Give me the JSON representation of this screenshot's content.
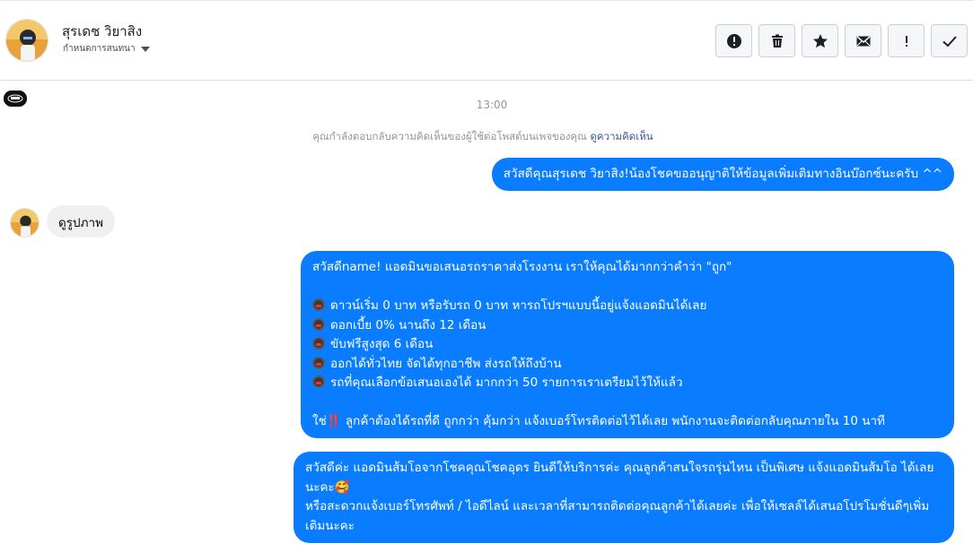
{
  "header": {
    "contact_name": "สุรเดช วิยาสิง",
    "subtitle": "กำหนดการสนทนา",
    "actions": [
      {
        "icon": "alert-circle-icon",
        "name": "report-button"
      },
      {
        "icon": "trash-icon",
        "name": "delete-button"
      },
      {
        "icon": "star-icon",
        "name": "star-button"
      },
      {
        "icon": "mail-icon",
        "name": "mark-unread-button"
      },
      {
        "icon": "exclamation-icon",
        "name": "follow-up-button"
      },
      {
        "icon": "check-icon",
        "name": "done-button"
      }
    ]
  },
  "thread": {
    "time": "13:00",
    "notice_text": "คุณกำลังตอบกลับความคิดเห็นของผู้ใช้ต่อโพสต์บนเพจของคุณ ",
    "notice_link": "ดูความคิดเห็น",
    "messages": {
      "m1": "สวัสดีคุณสุรเดช วิยาสิง!น้องโชคขออนุญาติให้ข้อมูลเพิ่มเติมทางอินบ๊อกซ์นะครับ ^^",
      "m2": "ดูรูปภาพ",
      "m3": {
        "l1": "สวัสดีname! แอดมินขอเสนอรถราคาส่งโรงงาน เราให้คุณได้มากกว่าคำว่า \"ถูก\"",
        "l2": "ดาวน์เริ่ม 0 บาท หรือรับรถ 0 บาท หารถโปรฯแบบนี้อยู่แจ้งแอดมินได้เลย",
        "l3": "ดอกเบี้ย 0% นานถึง 12 เดือน",
        "l4": "ขับฟรีสูงสุด 6 เดือน",
        "l5": "ออกได้ทั่วไทย จัดได้ทุกอาชีพ ส่งรถให้ถึงบ้าน",
        "l6": "รถที่คุณเลือกข้อเสนอเองได้ มากกว่า 50 รายการเราเตรียมไว้ให้แล้ว",
        "l7a": "ใช่",
        "l7b": "‼️",
        "l7c": " ลูกค้าต้องได้รถที่ดี ถูกกว่า คุ้มกว่า แจ้งเบอร์โทรติดต่อไว้ได้เลย พนักงานจะติดต่อกลับคุณภายใน 10 นาที"
      },
      "m4": {
        "p1": "สวัสดีค่ะ แอดมินส้มโอจากโชคคุณโชคอุดร ยินดีให้บริการค่ะ   คุณลูกค้าสนใจรถรุ่นไหน เป็นพิเศษ แจ้งแอดมินส้มโอ ได้เลยนะคะ🥰",
        "p2": "หรือสะดวกแจ้งเบอร์โทรศัพท์ / ไอดีไลน์ และเวลาที่สามารถติดต่อคุณลูกค้าได้เลยค่ะ เพื่อให้เซลล์ได้เสนอโปรโมชั่นดีๆเพิ่มเติมนะคะ"
      }
    }
  },
  "colors": {
    "outgoing_bubble": "#0a7cff",
    "incoming_bubble": "#f0f0f0",
    "link": "#385898"
  }
}
